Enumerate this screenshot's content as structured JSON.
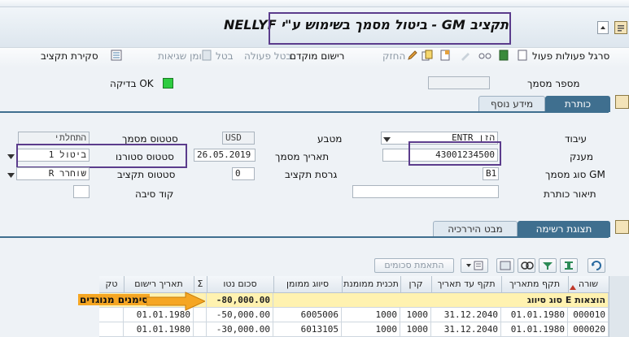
{
  "header": {
    "title": "תקציב GM - ביטול מסמך בשימוש ע\"י NELLYF"
  },
  "toolbar": {
    "items": [
      "סרגל פעולות פעול",
      "רישום מוקדם",
      "החזק",
      "בטל פעולה",
      "בטל",
      "יומן שגיאות",
      "סקירת תקציב"
    ]
  },
  "header_fields": {
    "doc_number_label": "מספר מסמך",
    "doc_number_value": "",
    "check_ok_label": "בדיקה OK"
  },
  "tabs_top": [
    "כותרת",
    "מידע נוסף"
  ],
  "form": {
    "processing_label": "עיבוד",
    "processing_value": "ENTR הזן",
    "grantor_label": "מענק",
    "grantor_value": "43001234500",
    "gm_doc_type_label": "סוג מסמך GM",
    "gm_doc_type_value": "B1",
    "header_desc_label": "תיאור כותרת",
    "header_desc_value": "",
    "currency_label": "מטבע",
    "currency_value": "USD",
    "doc_date_label": "תאריך מסמך",
    "doc_date_value": "26.05.2019",
    "budget_version_label": "גרסת תקציב",
    "budget_version_value": "0",
    "doc_status_label": "סטטוס מסמך",
    "doc_status_value": "התחלתי",
    "reversal_status_label": "סטטוס סטורנו",
    "reversal_status_value": "1 ביטול",
    "budget_status_label": "סטטוס תקציב",
    "budget_status_value": "R שוחרר",
    "reason_code_label": "קוד סיבה",
    "reason_code_value": ""
  },
  "tabs_bottom": [
    "תצוגת רשימה",
    "מבט היררכיה"
  ],
  "grid_toolbar": {
    "match_button": "התאמת סכומים"
  },
  "table": {
    "columns": [
      "שורה",
      "תקף מתאריך",
      "תקף עד תאריך",
      "קרן",
      "תכנית ממומנת",
      "סיווג ממומן",
      "סכום נטו",
      "Σ",
      "תאריך רישום",
      "טק"
    ],
    "summary_row": {
      "label": "סוג סיווג E הוצאות",
      "amount": "-80,000.00"
    },
    "rows": [
      [
        "000010",
        "01.01.1980",
        "31.12.2040",
        "1000",
        "1000",
        "6005006",
        "-50,000.00",
        "",
        "01.01.1980",
        ""
      ],
      [
        "000020",
        "01.01.1980",
        "31.12.2040",
        "1000",
        "1000",
        "6013105",
        "-30,000.00",
        "",
        "01.01.1980",
        ""
      ]
    ]
  },
  "annotation": {
    "text": "סימנים מנוגדים"
  },
  "colors": {
    "accent": "#3f6f8f",
    "highlight_box": "#5b3c8c",
    "arrow": "#f5a623",
    "summary_bg": "#fff2b0",
    "ok_green": "#2ecc40"
  }
}
